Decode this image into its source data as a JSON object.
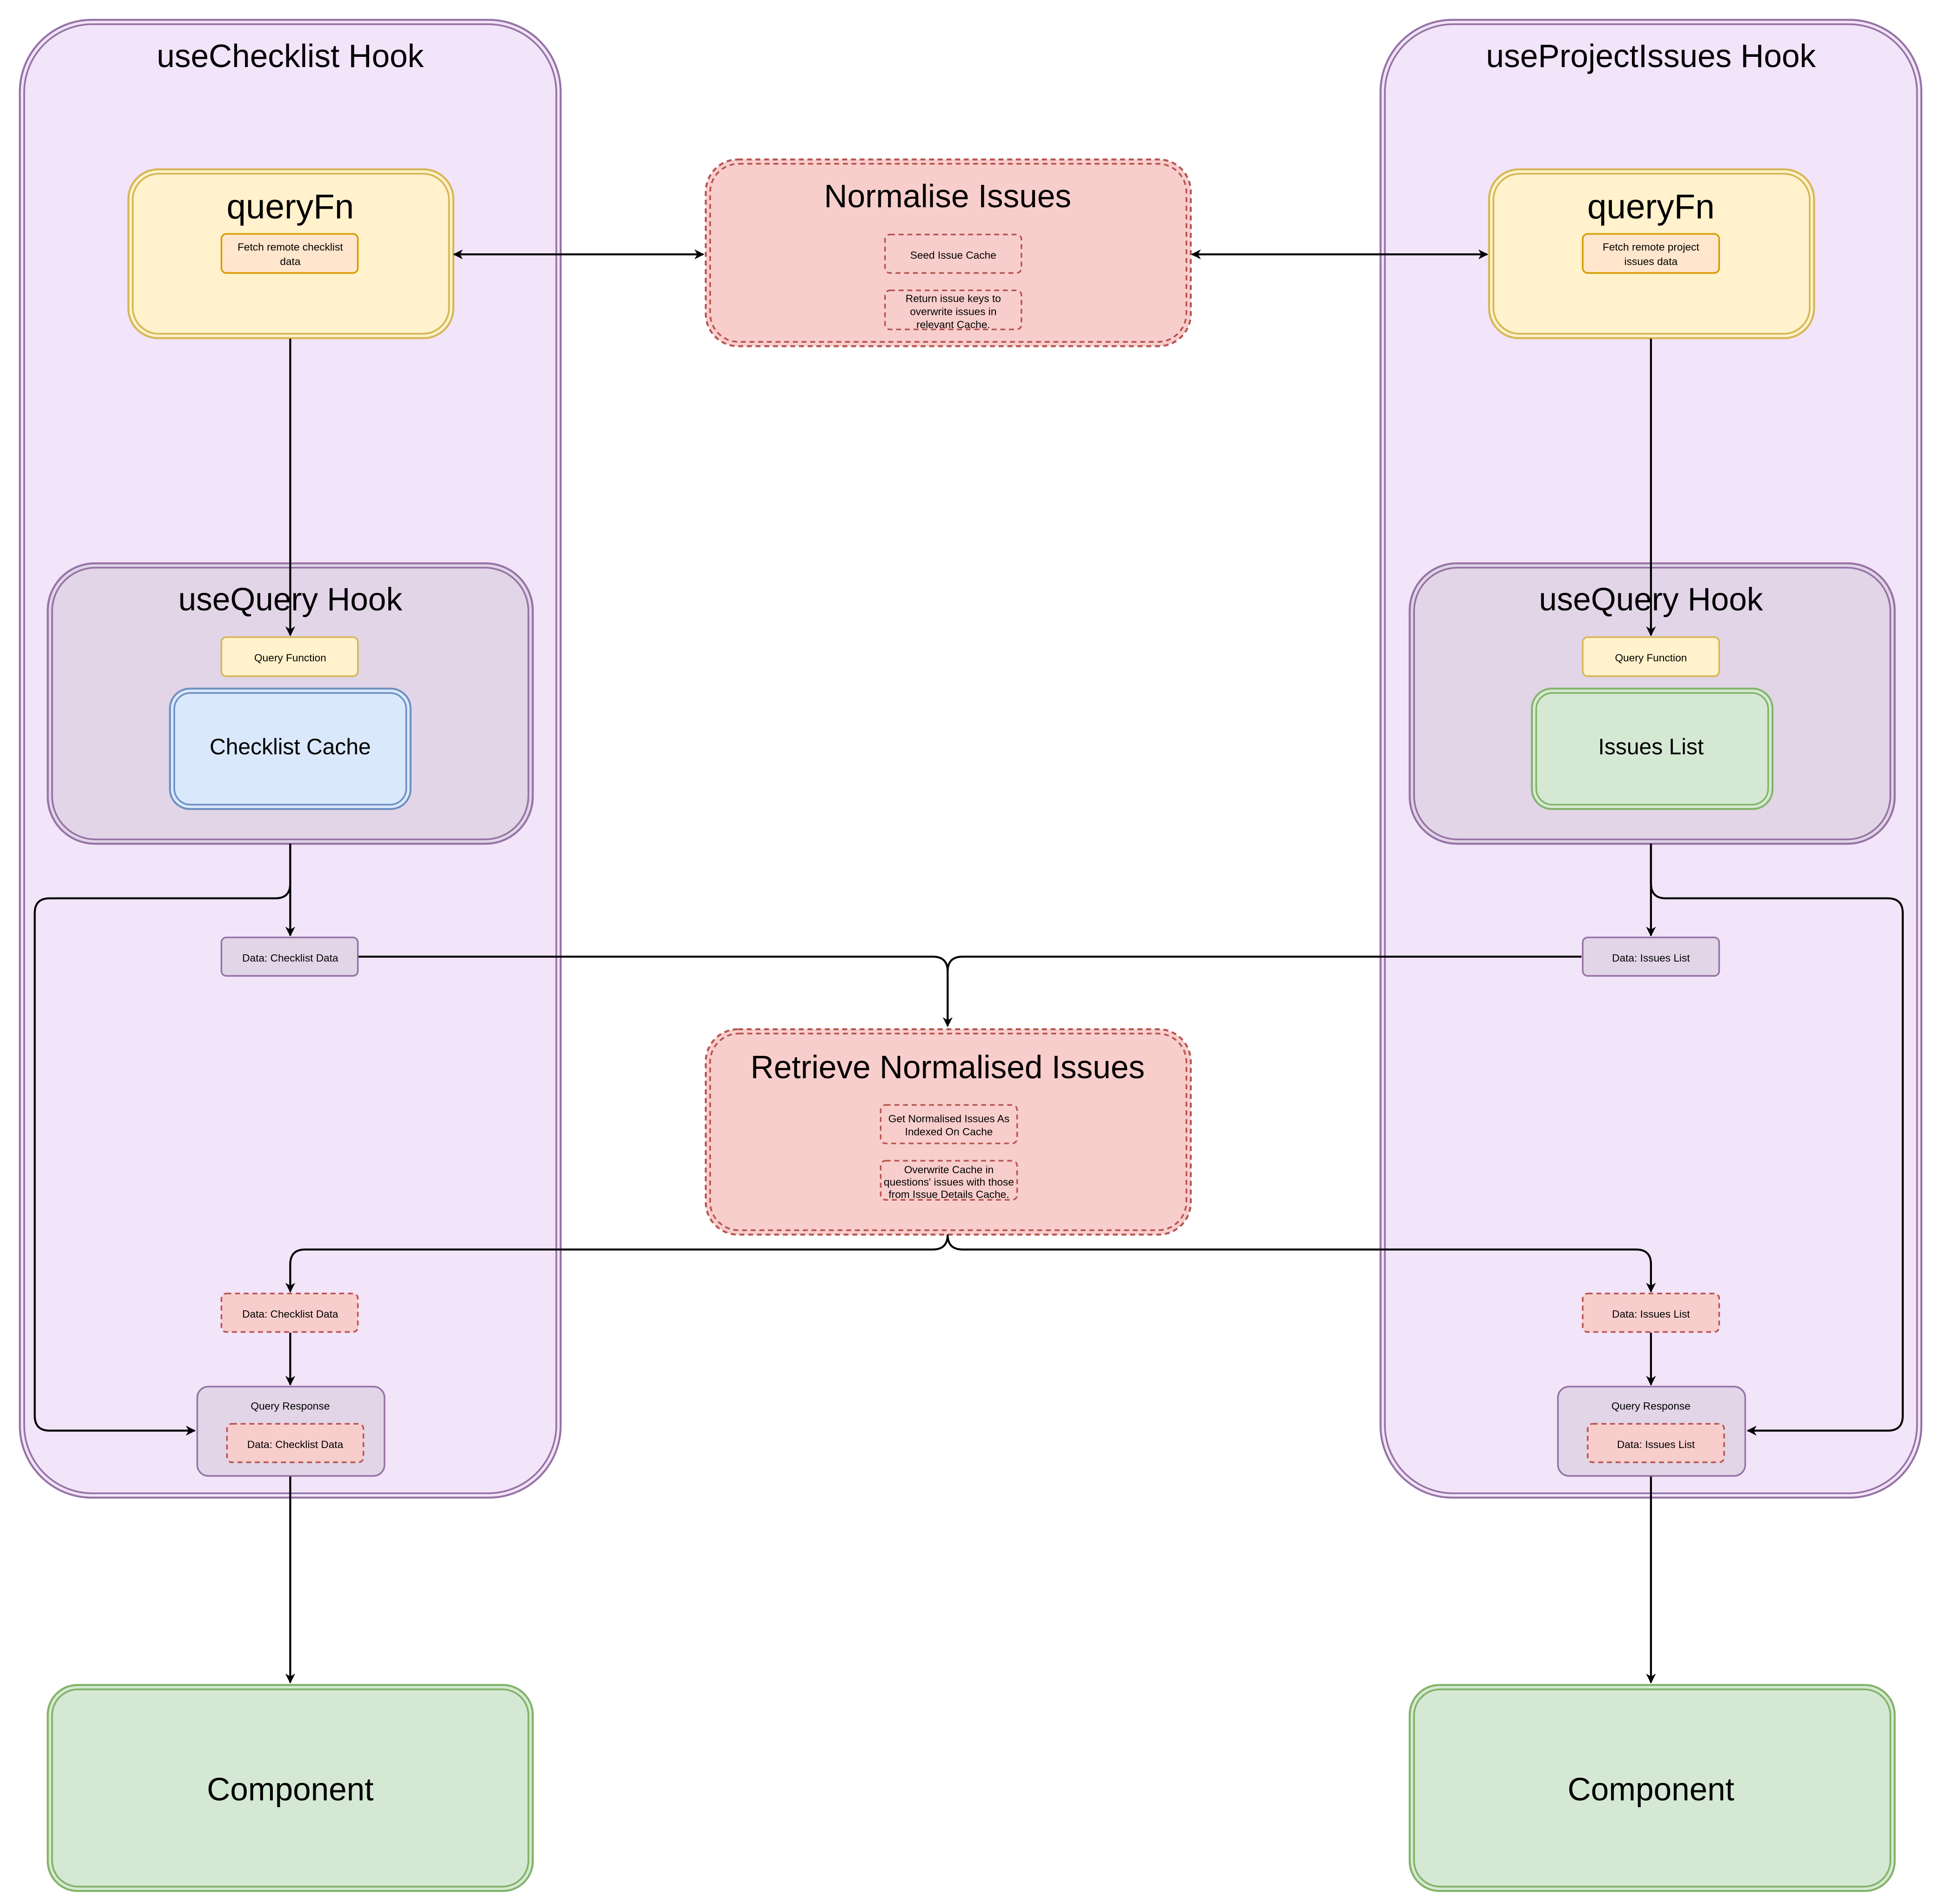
{
  "colors": {
    "hook_fill": "#f2e4f9",
    "hook_stroke": "#9673a6",
    "usequery_fill": "#e1d5e7",
    "queryfn_fill": "#fff2cc",
    "queryfn_stroke": "#d6b656",
    "fetch_fill": "#ffe6cc",
    "fetch_stroke": "#d79b00",
    "cache_fill": "#dae8fc",
    "cache_stroke": "#6c8ebf",
    "green_fill": "#d5e8d4",
    "green_stroke": "#82b366",
    "red_fill": "#f8cecc",
    "red_stroke": "#b85450",
    "edge": "#000000"
  },
  "left_hook": {
    "title": "useChecklist Hook",
    "query_fn": {
      "title": "queryFn",
      "task": [
        "Fetch remote checklist",
        "data"
      ]
    },
    "use_query": {
      "title": "useQuery Hook",
      "query_function_label": "Query Function",
      "cache_label": "Checklist Cache"
    },
    "data_out_label": "Data: Checklist Data",
    "normalised_data_label": "Data: Checklist Data",
    "query_response": {
      "title": "Query Response",
      "data_label": "Data: Checklist Data"
    },
    "component_label": "Component"
  },
  "right_hook": {
    "title": "useProjectIssues Hook",
    "query_fn": {
      "title": "queryFn",
      "task": [
        "Fetch remote project",
        "issues data"
      ]
    },
    "use_query": {
      "title": "useQuery Hook",
      "query_function_label": "Query Function",
      "cache_label": "Issues List"
    },
    "data_out_label": "Data: Issues List",
    "normalised_data_label": "Data: Issues List",
    "query_response": {
      "title": "Query Response",
      "data_label": "Data: Issues List"
    },
    "component_label": "Component"
  },
  "normalise": {
    "title": "Normalise Issues",
    "steps": [
      [
        "Seed Issue Cache"
      ],
      [
        "Return issue keys to",
        "overwrite issues in",
        "relevant Cache."
      ]
    ]
  },
  "retrieve": {
    "title": "Retrieve Normalised Issues",
    "steps": [
      [
        "Get Normalised Issues As",
        "Indexed On Cache"
      ],
      [
        "Overwrite Cache in",
        "questions'  issues with those",
        "from Issue Details Cache."
      ]
    ]
  }
}
